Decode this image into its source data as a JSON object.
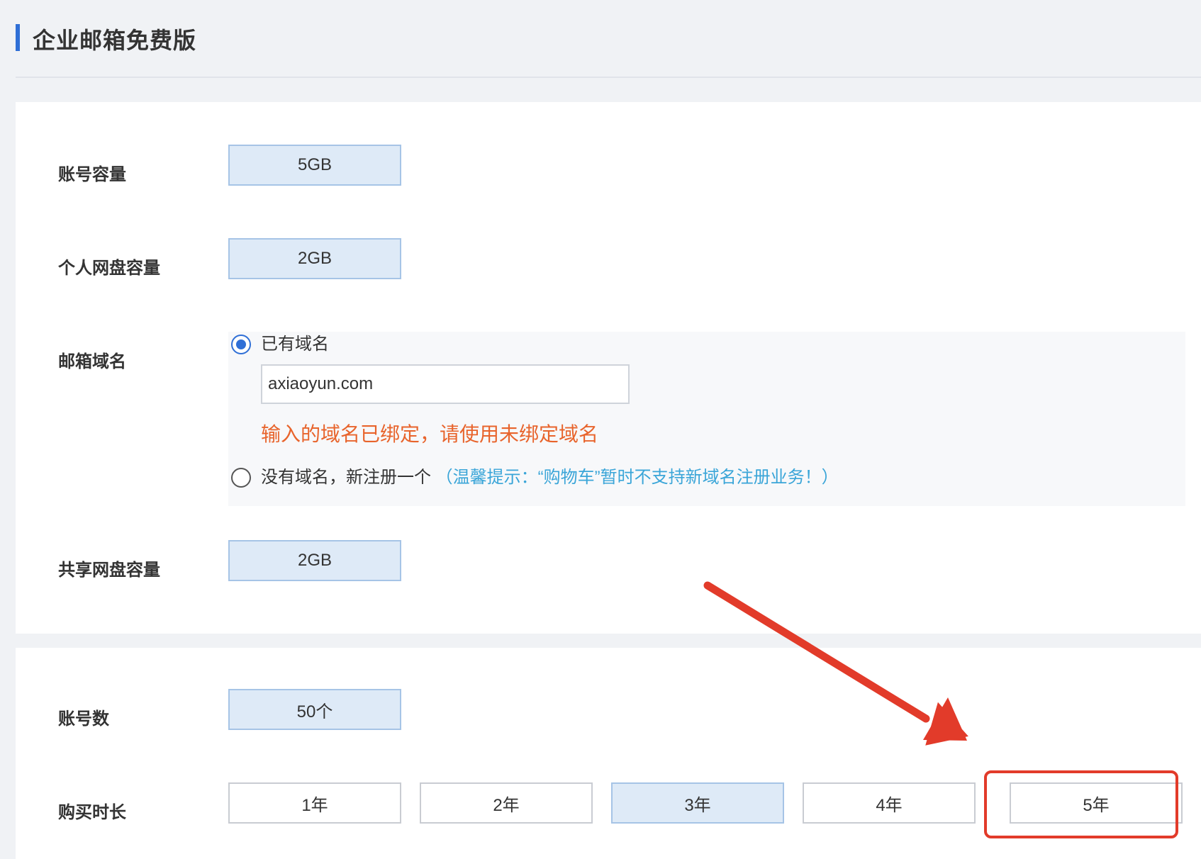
{
  "header": {
    "title": "企业邮箱免费版"
  },
  "specs": {
    "account_capacity": {
      "label": "账号容量",
      "value": "5GB"
    },
    "personal_disk": {
      "label": "个人网盘容量",
      "value": "2GB"
    },
    "mail_domain": {
      "label": "邮箱域名",
      "options": [
        {
          "label": "已有域名",
          "checked": true
        },
        {
          "label": "没有域名，新注册一个",
          "checked": false
        }
      ],
      "input_value": "axiaoyun.com",
      "error_message": "输入的域名已绑定，请使用未绑定域名",
      "tip": "（温馨提示：“购物车”暂时不支持新域名注册业务！）"
    },
    "shared_disk": {
      "label": "共享网盘容量",
      "value": "2GB"
    }
  },
  "purchase": {
    "account_count": {
      "label": "账号数",
      "value": "50个"
    },
    "duration": {
      "label": "购买时长",
      "options": [
        "1年",
        "2年",
        "3年",
        "4年",
        "5年"
      ],
      "selected": "3年"
    }
  },
  "annotation": {
    "highlighted_option": "5年",
    "color": "#e23b2a"
  },
  "colors": {
    "accent": "#2f6fd6",
    "selected_bg": "#deeaf7",
    "selected_border": "#a6c4e6",
    "error": "#e8642c",
    "tip": "#3aa5d8"
  }
}
